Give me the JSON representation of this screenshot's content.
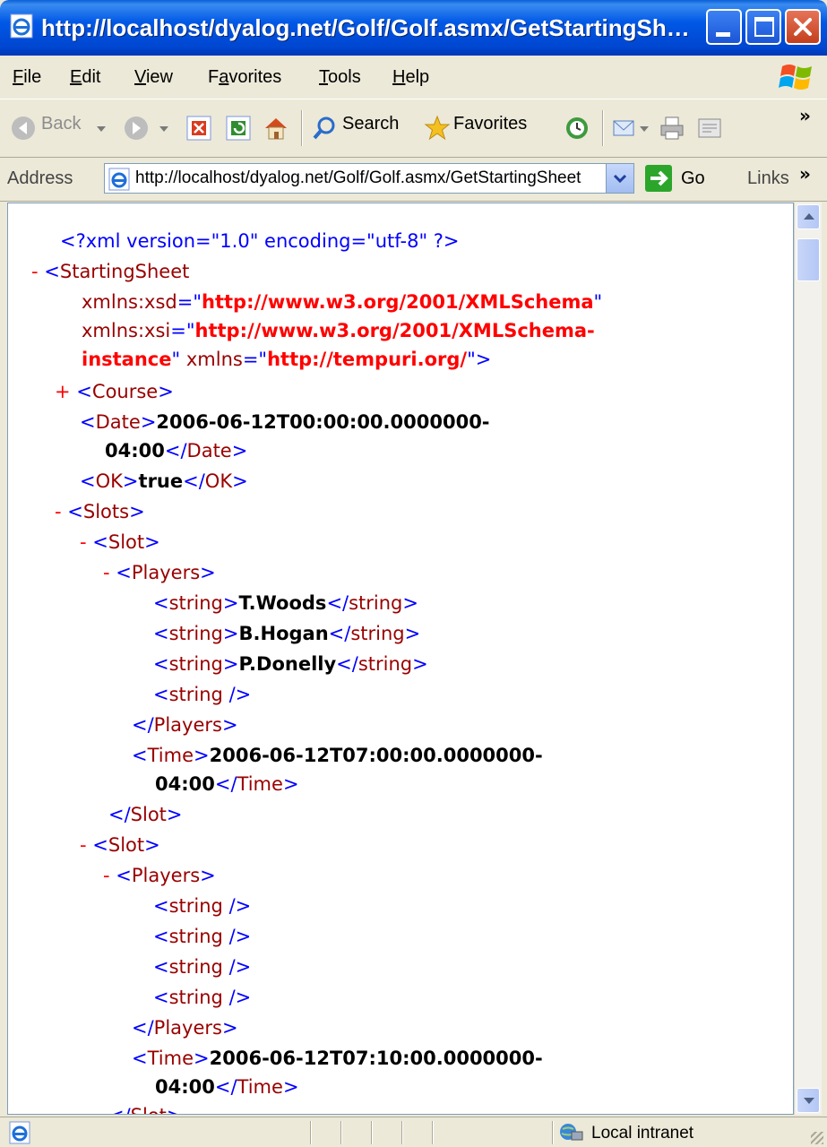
{
  "window": {
    "title": "http://localhost/dyalog.net/Golf/Golf.asmx/GetStartingSh…"
  },
  "menu": {
    "items": [
      {
        "pre": "",
        "key": "F",
        "post": "ile"
      },
      {
        "pre": "",
        "key": "E",
        "post": "dit"
      },
      {
        "pre": "",
        "key": "V",
        "post": "iew"
      },
      {
        "pre": "F",
        "key": "a",
        "post": "vorites"
      },
      {
        "pre": "",
        "key": "T",
        "post": "ools"
      },
      {
        "pre": "",
        "key": "H",
        "post": "elp"
      }
    ]
  },
  "toolbar": {
    "back_label": "Back",
    "search_label": "Search",
    "favorites_label": "Favorites",
    "more": "»"
  },
  "address": {
    "label": "Address",
    "url": "http://localhost/dyalog.net/Golf/Golf.asmx/GetStartingSheet",
    "go_label": "Go",
    "links_label": "Links",
    "more": "»"
  },
  "xml": {
    "declaration": "<?xml version=\"1.0\" encoding=\"utf-8\" ?>",
    "root_name": "StartingSheet",
    "ns": [
      {
        "attr": "xmlns:xsd",
        "value": "http://www.w3.org/2001/XMLSchema"
      },
      {
        "attr": "xmlns:xsi",
        "value_part1": "http://www.w3.org/2001/XMLSchema-",
        "value_part2": "instance"
      },
      {
        "attr": "xmlns",
        "value": "http://tempuri.org/"
      }
    ],
    "course_tag": "Course",
    "date_tag": "Date",
    "date_value_1": "2006-06-12T00:00:00.0000000-",
    "date_value_2": "04:00",
    "ok_tag": "OK",
    "ok_value": "true",
    "slots_tag": "Slots",
    "slot_tag": "Slot",
    "players_tag": "Players",
    "string_tag": "string",
    "time_tag": "Time",
    "slot1": {
      "players": [
        "T.Woods",
        "B.Hogan",
        "P.Donelly"
      ],
      "time_1": "2006-06-12T07:00:00.0000000-",
      "time_2": "04:00"
    },
    "slot2": {
      "time_1": "2006-06-12T07:10:00.0000000-",
      "time_2": "04:00"
    }
  },
  "status": {
    "zone": "Local intranet"
  }
}
